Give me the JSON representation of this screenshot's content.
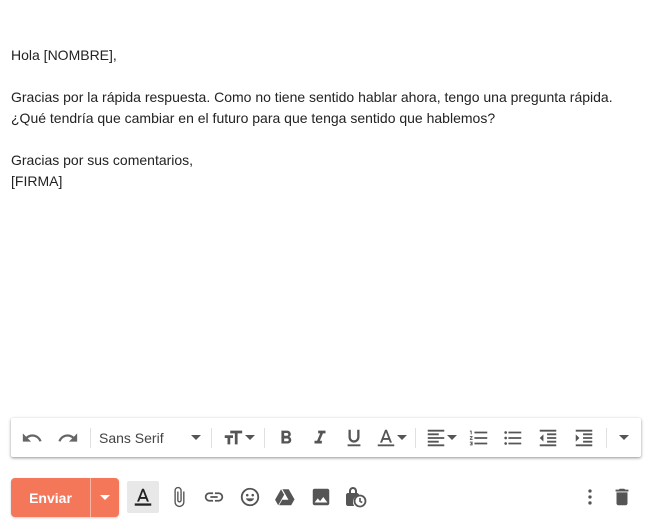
{
  "email_body": {
    "greeting": "Hola [NOMBRE],",
    "line1": "Gracias por la rápida respuesta. Como no tiene sentido hablar ahora, tengo una pregunta rápida.",
    "line2": "¿Qué tendría que cambiar en el futuro para que tenga sentido que hablemos?",
    "closing": "Gracias por sus comentarios,",
    "signature": "[FIRMA]"
  },
  "toolbar": {
    "font_family": "Sans Serif",
    "buttons": [
      "undo-icon",
      "redo-icon",
      "text-size-icon",
      "bold-icon",
      "italic-icon",
      "underline-icon",
      "text-color-icon",
      "align-icon",
      "numbered-list-icon",
      "bulleted-list-icon",
      "indent-less-icon",
      "indent-more-icon",
      "more-formatting-icon"
    ]
  },
  "actions": {
    "send_label": "Enviar",
    "accent_color": "#f5775a",
    "icons": [
      "formatting-options-icon",
      "attach-icon",
      "link-icon",
      "emoji-icon",
      "drive-icon",
      "photo-icon",
      "confidential-mode-icon",
      "more-options-icon",
      "trash-icon"
    ]
  }
}
